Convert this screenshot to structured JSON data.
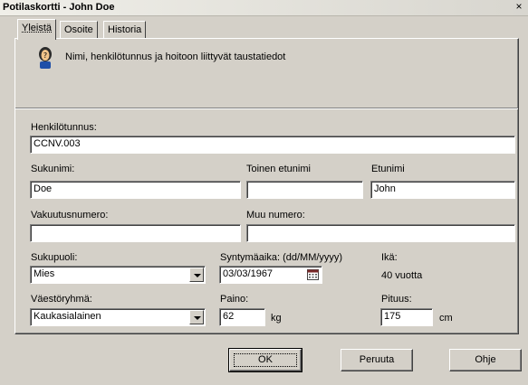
{
  "window": {
    "title": "Potilaskortti - John Doe",
    "close_glyph": "×"
  },
  "tabs": [
    {
      "label": "Yleistä",
      "active": true
    },
    {
      "label": "Osoite",
      "active": false
    },
    {
      "label": "Historia",
      "active": false
    }
  ],
  "info": {
    "icon": "help-person-icon",
    "text": "Nimi, henkilötunnus ja hoitoon liittyvät taustatiedot"
  },
  "form": {
    "henkilotunnus": {
      "label": "Henkilötunnus:",
      "value": "CCNV.003"
    },
    "sukunimi": {
      "label": "Sukunimi:",
      "value": "Doe"
    },
    "toinen_etunimi": {
      "label": "Toinen etunimi",
      "value": ""
    },
    "etunimi": {
      "label": "Etunimi",
      "value": "John"
    },
    "vakuutusnumero": {
      "label": "Vakuutusnumero:",
      "value": ""
    },
    "muu_numero": {
      "label": "Muu numero:",
      "value": ""
    },
    "sukupuoli": {
      "label": "Sukupuoli:",
      "value": "Mies"
    },
    "syntymaaika": {
      "label": "Syntymäaika:  (dd/MM/yyyy)",
      "value": "03/03/1967"
    },
    "ika": {
      "label": "Ikä:",
      "value": "40 vuotta"
    },
    "vaestoryhma": {
      "label": "Väestöryhmä:",
      "value": "Kaukasialainen"
    },
    "paino": {
      "label": "Paino:",
      "value": "62",
      "unit": "kg"
    },
    "pituus": {
      "label": "Pituus:",
      "value": "175",
      "unit": "cm"
    }
  },
  "buttons": {
    "ok": "OK",
    "cancel": "Peruuta",
    "help": "Ohje"
  }
}
